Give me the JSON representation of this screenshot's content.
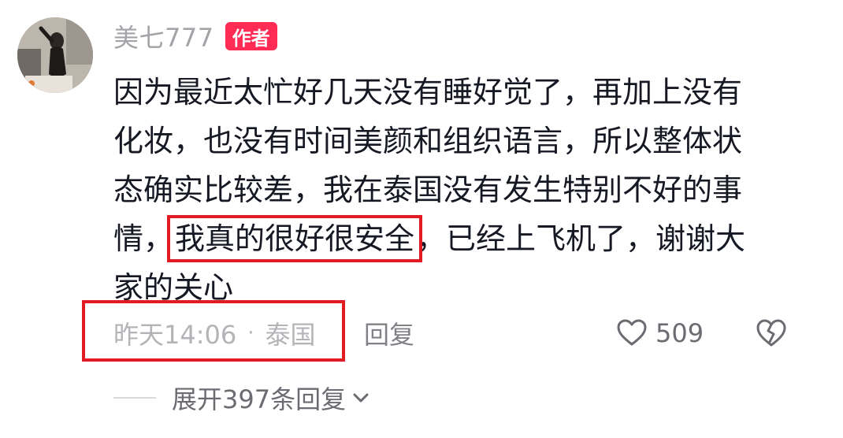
{
  "comment": {
    "avatar_icon": "user-avatar-photo",
    "username": "美七777",
    "author_badge": "作者",
    "text_lines": [
      "因为最近太忙好几天没有睡好觉了，再加上没有",
      "化妆，也没有时间美颜和组织语言，所以整体状",
      "态确实比较差，我在泰国没有发生特别不好的事"
    ],
    "line4_before": "情，",
    "line4_highlight": "我真的很好很安全",
    "line4_after": "，已经上飞机了，谢谢大",
    "line5": "家的关心",
    "timestamp": "昨天14:06",
    "separator": "·",
    "location": "泰国",
    "reply_label": "回复",
    "like_icon": "heart-outline-icon",
    "like_count": "509",
    "dislike_icon": "broken-heart-icon",
    "expand_label": "展开397条回复",
    "expand_icon": "chevron-down-icon"
  },
  "colors": {
    "badge": "#fe2c55",
    "highlight_box": "#e21a22",
    "text": "#161823",
    "muted": "#a3a3a8"
  }
}
